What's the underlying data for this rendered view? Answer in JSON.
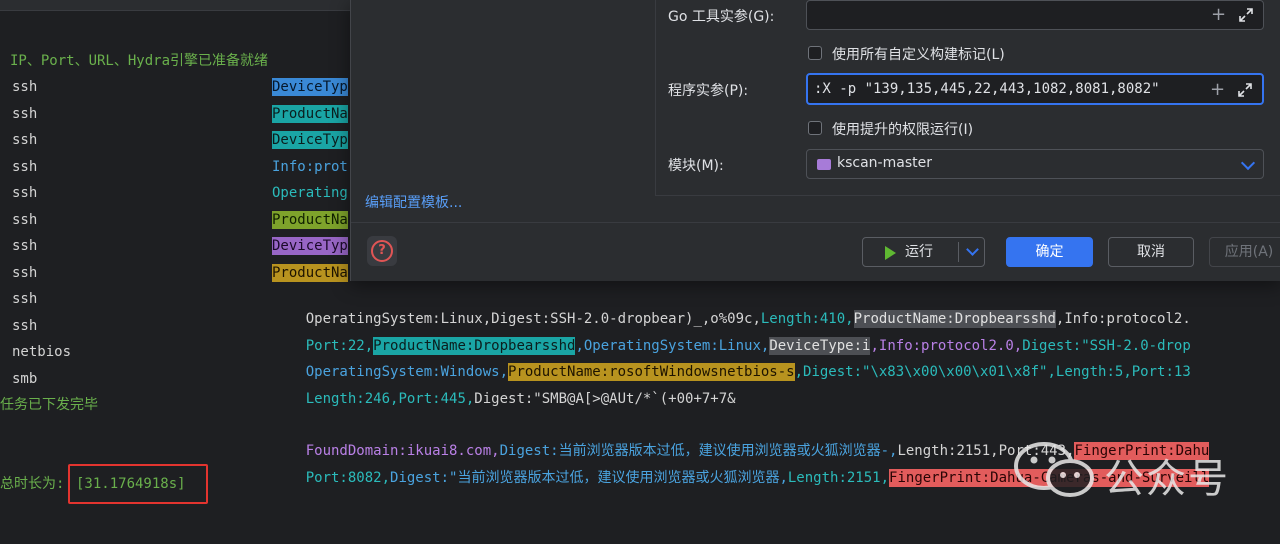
{
  "terminal": {
    "ready_message": "IP、Port、URL、Hydra引擎已准备就绪",
    "services": [
      "ssh",
      "ssh",
      "ssh",
      "ssh",
      "ssh",
      "ssh",
      "ssh",
      "ssh",
      "ssh",
      "ssh",
      "netbios",
      "smb"
    ],
    "tasks_done": "任务已下发完毕",
    "elapsed_prefix": "总时长为:",
    "elapsed_value": "[31.1764918s]",
    "left_fragments": [
      "DeviceTyp",
      "ProductNa",
      "DeviceTyp",
      "Info:prot",
      "Operating",
      "ProductNa",
      "DeviceTyp",
      "ProductNa"
    ],
    "lines": {
      "l9": {
        "a": "OperatingSystem:Linux,",
        "b": "Digest:SSH-2.0-dropbear)_,o%09c,",
        "c": "Length:410,",
        "d": "ProductName:Dropbearsshd",
        "e": ",Info:protocol2."
      },
      "l10": {
        "a": "Port:22,",
        "b": "ProductName:Dropbearsshd",
        "c": ",OperatingSystem:Linux,",
        "d": "DeviceType:i",
        "e": ",Info:protocol2.0,",
        "f": "Digest:\"SSH-2.0-drop"
      },
      "l11": {
        "a": "OperatingSystem:Windows,",
        "b": "ProductName:rosoftWindowsnetbios-s",
        "c": ",Digest:\"\\x83\\x00\\x00\\x01\\x8f\",",
        "d": "Length:5,Port:13"
      },
      "l12": {
        "a": "Length:246,",
        "b": "Port:445,",
        "c": "Digest:\"SMB@A[>@AUt/*`(+00+7+7&"
      },
      "l14": {
        "a": "FoundDomain:ikuai8.com,",
        "b": "Digest:当前浏览器版本过低，建议使用浏览器或火狐浏览器-,",
        "c": "Length:2151,Port:443,",
        "d": "FingerPrint:Dahu"
      },
      "l15": {
        "a": "Port:8082,",
        "b": "Digest:\"当前浏览器版本过低，建议使用浏览器或火狐浏览器,",
        "c": "Length:2151,",
        "d": "FingerPrint:Dahua-Cameras-and-Surveill"
      }
    }
  },
  "dialog": {
    "edit_templates_link": "编辑配置模板...",
    "go_tool_args_label": "Go 工具实参(G):",
    "go_tool_args_value": "",
    "use_all_tags_label": "使用所有自定义构建标记(L)",
    "program_args_label": "程序实参(P):",
    "program_args_value": ":X -p \"139,135,445,22,443,1082,8081,8082\"",
    "elevated_label": "使用提升的权限运行(I)",
    "module_label": "模块(M):",
    "module_value": "kscan-master",
    "run_button": "运行",
    "ok_button": "确定",
    "cancel_button": "取消",
    "apply_button": "应用(A)"
  },
  "watermark": {
    "text": "公众号"
  }
}
